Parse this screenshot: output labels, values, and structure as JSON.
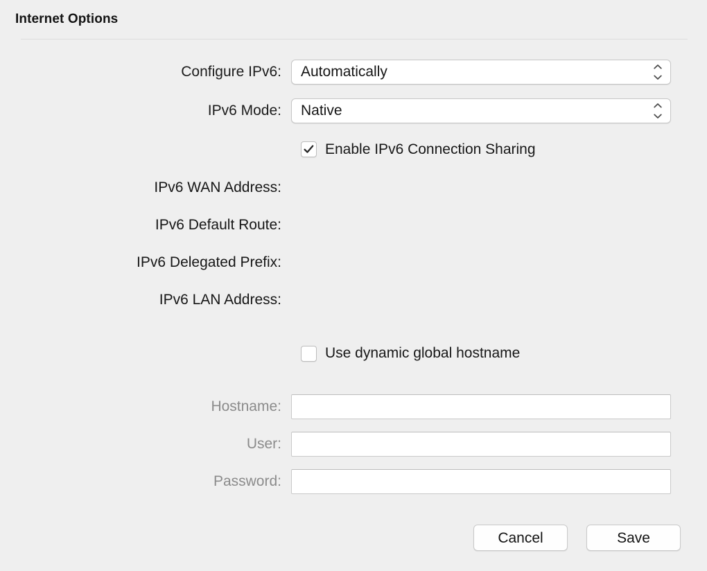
{
  "window": {
    "title": "Internet Options"
  },
  "form": {
    "configure_ipv6": {
      "label": "Configure IPv6:",
      "value": "Automatically"
    },
    "ipv6_mode": {
      "label": "IPv6 Mode:",
      "value": "Native"
    },
    "enable_sharing": {
      "label": "Enable IPv6 Connection Sharing",
      "checked": "true"
    },
    "readonly_rows": [
      {
        "label": "IPv6 WAN Address:",
        "value": ""
      },
      {
        "label": "IPv6 Default Route:",
        "value": ""
      },
      {
        "label": "IPv6 Delegated Prefix:",
        "value": ""
      },
      {
        "label": "IPv6 LAN Address:",
        "value": ""
      }
    ],
    "dynamic_hostname": {
      "label": "Use dynamic global hostname",
      "checked": "false"
    },
    "hostname": {
      "label": "Hostname:",
      "value": "",
      "placeholder": ""
    },
    "user": {
      "label": "User:",
      "value": "",
      "placeholder": ""
    },
    "password": {
      "label": "Password:",
      "value": "",
      "placeholder": ""
    }
  },
  "footer": {
    "cancel_label": "Cancel",
    "save_label": "Save"
  },
  "colors": {
    "background": "#efefef",
    "text": "#1c1c1c",
    "muted_text": "#8b8b8b",
    "field_background": "#ffffff",
    "border": "#c6c6c6",
    "divider": "#dcdcdc"
  }
}
